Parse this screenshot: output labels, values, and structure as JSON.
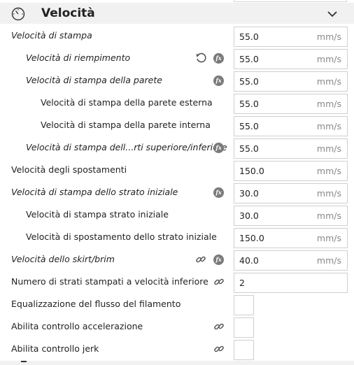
{
  "section": {
    "title": "Velocità",
    "icon": "speedometer-icon",
    "collapse_icon": "chevron-down-icon"
  },
  "settings": [
    {
      "label": "Velocità di stampa",
      "value": "55.0",
      "unit": "mm/s"
    },
    {
      "label": "Velocità di riempimento",
      "value": "55.0",
      "unit": "mm/s"
    },
    {
      "label": "Velocità di stampa della parete",
      "value": "55.0",
      "unit": "mm/s"
    },
    {
      "label": "Velocità di stampa della parete esterna",
      "value": "55.0",
      "unit": "mm/s"
    },
    {
      "label": "Velocità di stampa della parete interna",
      "value": "55.0",
      "unit": "mm/s"
    },
    {
      "label": "Velocità di stampa dell...rti superiore/inferiore",
      "value": "55.0",
      "unit": "mm/s"
    },
    {
      "label": "Velocità degli spostamenti",
      "value": "150.0",
      "unit": "mm/s"
    },
    {
      "label": "Velocità di stampa dello strato iniziale",
      "value": "30.0",
      "unit": "mm/s"
    },
    {
      "label": "Velocità di stampa strato iniziale",
      "value": "30.0",
      "unit": "mm/s"
    },
    {
      "label": "Velocità di spostamento dello strato iniziale",
      "value": "150.0",
      "unit": "mm/s"
    },
    {
      "label": "Velocità dello skirt/brim",
      "value": "40.0",
      "unit": "mm/s"
    },
    {
      "label": "Numero di strati stampati a velocità inferiore",
      "value": "2",
      "unit": ""
    },
    {
      "label": "Equalizzazione del flusso del filamento"
    },
    {
      "label": "Abilita controllo accelerazione"
    },
    {
      "label": "Abilita controllo jerk"
    }
  ],
  "icons": {
    "fx": "fx",
    "reset": "reset-icon",
    "link": "link-icon"
  }
}
